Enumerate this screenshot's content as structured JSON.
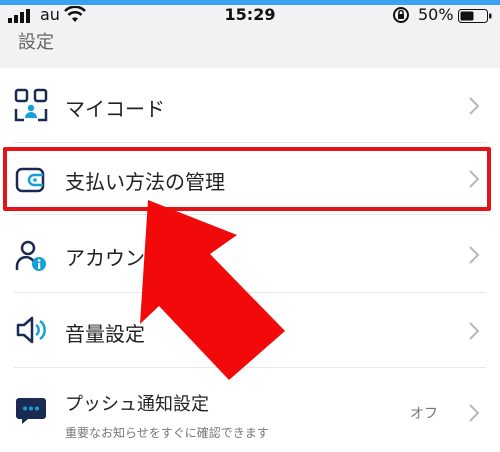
{
  "status_bar": {
    "carrier": "au",
    "time": "15:29",
    "battery": "50%"
  },
  "page": {
    "title": "設定"
  },
  "items": [
    {
      "label": "マイコード"
    },
    {
      "label": "支払い方法の管理"
    },
    {
      "label": "アカウン"
    },
    {
      "label": "音量設定"
    },
    {
      "label": "プッシュ通知設定",
      "subtitle": "重要なお知らせをすぐに確認できます",
      "value": "オフ"
    }
  ],
  "colors": {
    "highlight": "#e21418",
    "arrow": "#f20a0a",
    "icon": "#1a2a52",
    "accent": "#17a0d8",
    "status_bar_accent": "#3aa0ef"
  },
  "icons": {
    "my_code": "qr-code-icon",
    "payment": "wallet-icon",
    "account": "account-info-icon",
    "volume": "speaker-icon",
    "push": "chat-bubble-icon"
  }
}
